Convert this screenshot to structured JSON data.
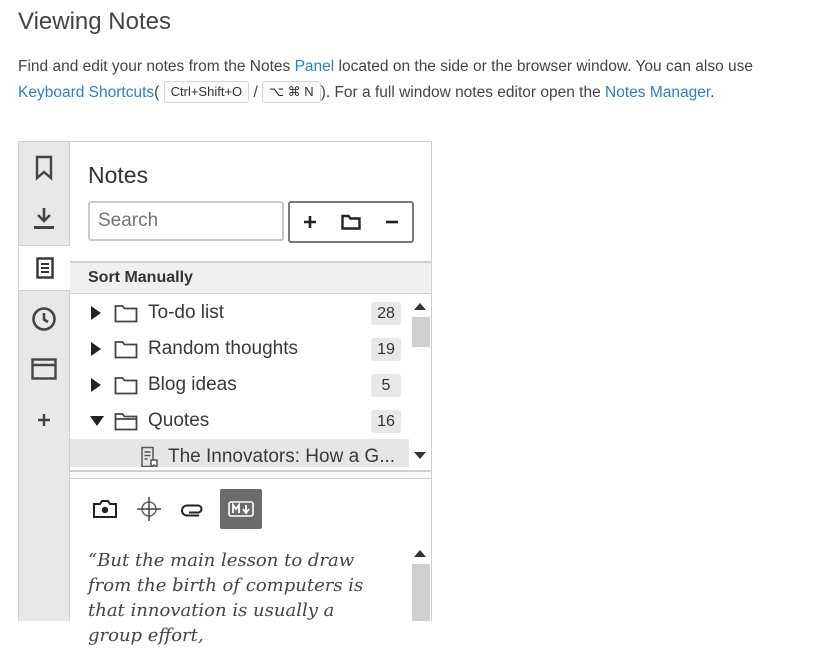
{
  "doc": {
    "title": "Viewing Notes",
    "p1": "Find and edit your notes from the Notes",
    "link_panel": "Panel",
    "p2": "located on the side or the browser window. You can also use",
    "link_shortcuts": "Keyboard Shortcuts",
    "open_paren": "(",
    "kbd_win": "Ctrl+Shift+O",
    "slash": "/",
    "kbd_mac": "⌥ ⌘ N",
    "p3": "). For a full window notes editor open the",
    "link_manager": "Notes Manager",
    "p4": "."
  },
  "sidebar": {
    "items": [
      {
        "icon": "bookmark-icon"
      },
      {
        "icon": "download-icon"
      },
      {
        "icon": "notes-icon",
        "active": true
      },
      {
        "icon": "history-icon"
      },
      {
        "icon": "window-icon"
      },
      {
        "icon": "add-icon",
        "label": "+"
      }
    ]
  },
  "notes_panel": {
    "title": "Notes",
    "search_placeholder": "Search",
    "sort_label": "Sort Manually",
    "tree": [
      {
        "label": "To-do list",
        "count": "28",
        "expanded": false
      },
      {
        "label": "Random thoughts",
        "count": "19",
        "expanded": false
      },
      {
        "label": "Blog ideas",
        "count": "5",
        "expanded": false
      },
      {
        "label": "Quotes",
        "count": "16",
        "expanded": true
      }
    ],
    "selected_note": "The Innovators: How a G...",
    "editor_text": "“But the main lesson to draw from the birth of computers is that innovation is usually a group effort,"
  },
  "colors": {
    "link": "#2f7fc1",
    "sidebar_bg": "#e8e8e8",
    "md_button": "#6b6b6b"
  }
}
